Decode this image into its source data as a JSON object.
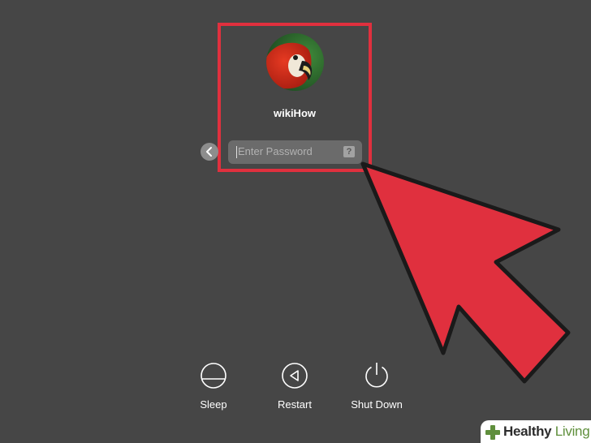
{
  "login": {
    "username": "wikiHow",
    "password_placeholder": "Enter Password",
    "hint_glyph": "?"
  },
  "power_actions": [
    {
      "label": "Sleep",
      "icon": "sleep-icon"
    },
    {
      "label": "Restart",
      "icon": "restart-icon"
    },
    {
      "label": "Shut Down",
      "icon": "shutdown-icon"
    }
  ],
  "watermark": {
    "word1": "Healthy",
    "word2": "Living"
  },
  "colors": {
    "background": "#464646",
    "highlight": "#e0303e",
    "field": "#6b6b6b",
    "watermark_accent": "#5f8f3c"
  }
}
